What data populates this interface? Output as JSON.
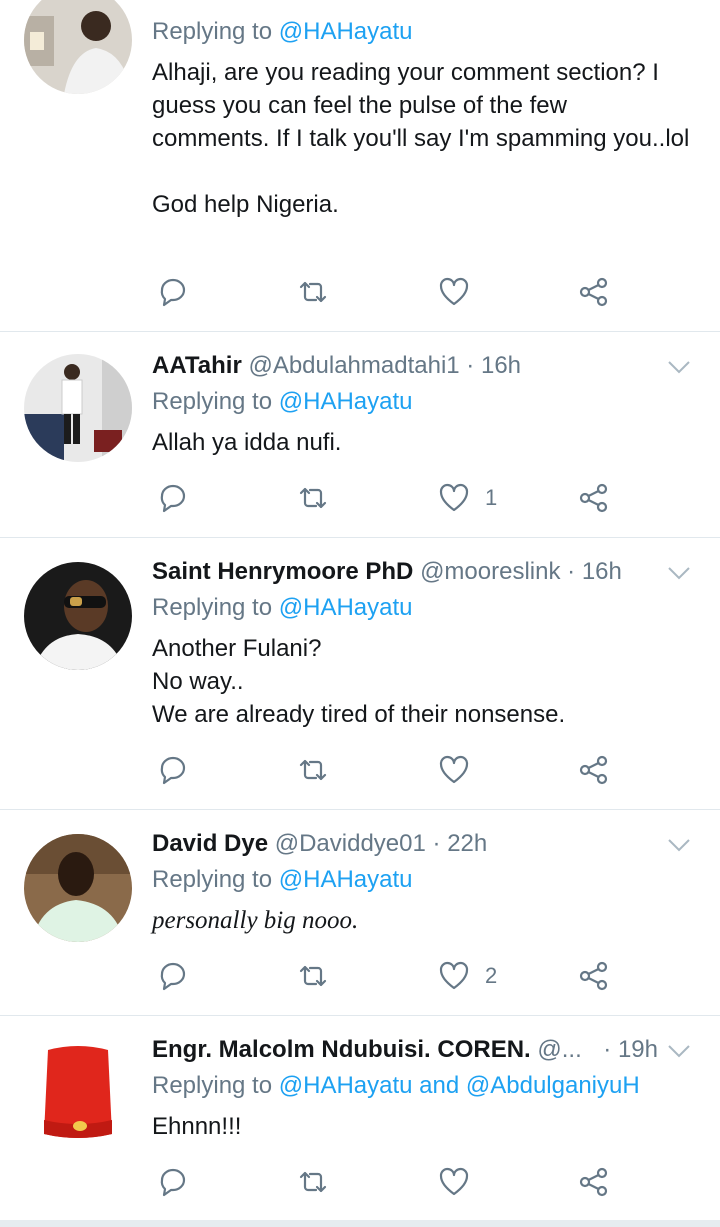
{
  "tweets": [
    {
      "name": "",
      "handle": "",
      "time": "",
      "reply_prefix": "Replying to",
      "reply_mentions": "@HAHayatu",
      "body": "Alhaji, are you reading your comment section? I guess you can feel the pulse of the few comments. If I talk you'll say I'm spamming you..lol\n\nGod help Nigeria.",
      "likes": ""
    },
    {
      "name": "AATahir",
      "handle": "@Abdulahmadtahi1",
      "time": "16h",
      "reply_prefix": "Replying to",
      "reply_mentions": "@HAHayatu",
      "body": "Allah ya idda nufi.",
      "likes": "1"
    },
    {
      "name": "Saint Henrymoore PhD",
      "handle": "@mooreslink",
      "time": "16h",
      "reply_prefix": "Replying to",
      "reply_mentions": "@HAHayatu",
      "body": "Another Fulani?\nNo way..\nWe are already tired of their nonsense.",
      "likes": ""
    },
    {
      "name": "David Dye",
      "handle": "@Daviddye01",
      "time": "22h",
      "reply_prefix": "Replying to",
      "reply_mentions": "@HAHayatu",
      "body": "personally big nooo.",
      "likes": "2"
    },
    {
      "name": "Engr. Malcolm Ndubuisi. COREN.",
      "handle": "@...",
      "time": "19h",
      "reply_prefix": "Replying to",
      "reply_mentions": "@HAHayatu and @AbdulganiyuH",
      "body": "Ehnnn!!!",
      "likes": ""
    }
  ],
  "separator": "·",
  "icons": [
    "reply-icon",
    "retweet-icon",
    "like-icon",
    "share-icon",
    "chevron-down-icon"
  ],
  "colors": {
    "link": "#1da1f2",
    "muted": "#657786",
    "text": "#14171a",
    "divider": "#e1e8ed"
  }
}
